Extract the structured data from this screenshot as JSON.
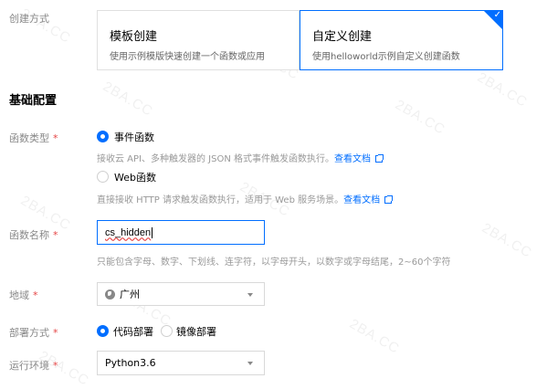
{
  "watermark": "2BA.CC",
  "creation_method": {
    "label": "创建方式",
    "cards": [
      {
        "title": "模板创建",
        "desc": "使用示例模版快速创建一个函数或应用",
        "selected": false
      },
      {
        "title": "自定义创建",
        "desc": "使用helloworld示例自定义创建函数",
        "selected": true
      }
    ],
    "selected_mark": "✓"
  },
  "basic_config": {
    "title": "基础配置"
  },
  "function_type": {
    "label": "函数类型",
    "required_mark": "*",
    "options": [
      {
        "label": "事件函数",
        "help": "接收云 API、多种触发器的 JSON 格式事件触发函数执行。",
        "link": "查看文档",
        "checked": true
      },
      {
        "label": "Web函数",
        "help": "直接接收 HTTP 请求触发函数执行，适用于 Web 服务场景。",
        "link": "查看文档",
        "checked": false
      }
    ]
  },
  "function_name": {
    "label": "函数名称",
    "required_mark": "*",
    "value": "cs_hidden",
    "help": "只能包含字母、数字、下划线、连字符，以字母开头，以数字或字母结尾，2~60个字符"
  },
  "region": {
    "label": "地域",
    "required_mark": "*",
    "value": "广州",
    "icon": "globe-icon"
  },
  "deploy_method": {
    "label": "部署方式",
    "required_mark": "*",
    "options": [
      {
        "label": "代码部署",
        "checked": true
      },
      {
        "label": "镜像部署",
        "checked": false
      }
    ]
  },
  "runtime": {
    "label": "运行环境",
    "required_mark": "*",
    "value": "Python3.6"
  },
  "colors": {
    "accent": "#006eff",
    "required": "#e54545",
    "muted": "#999999"
  }
}
